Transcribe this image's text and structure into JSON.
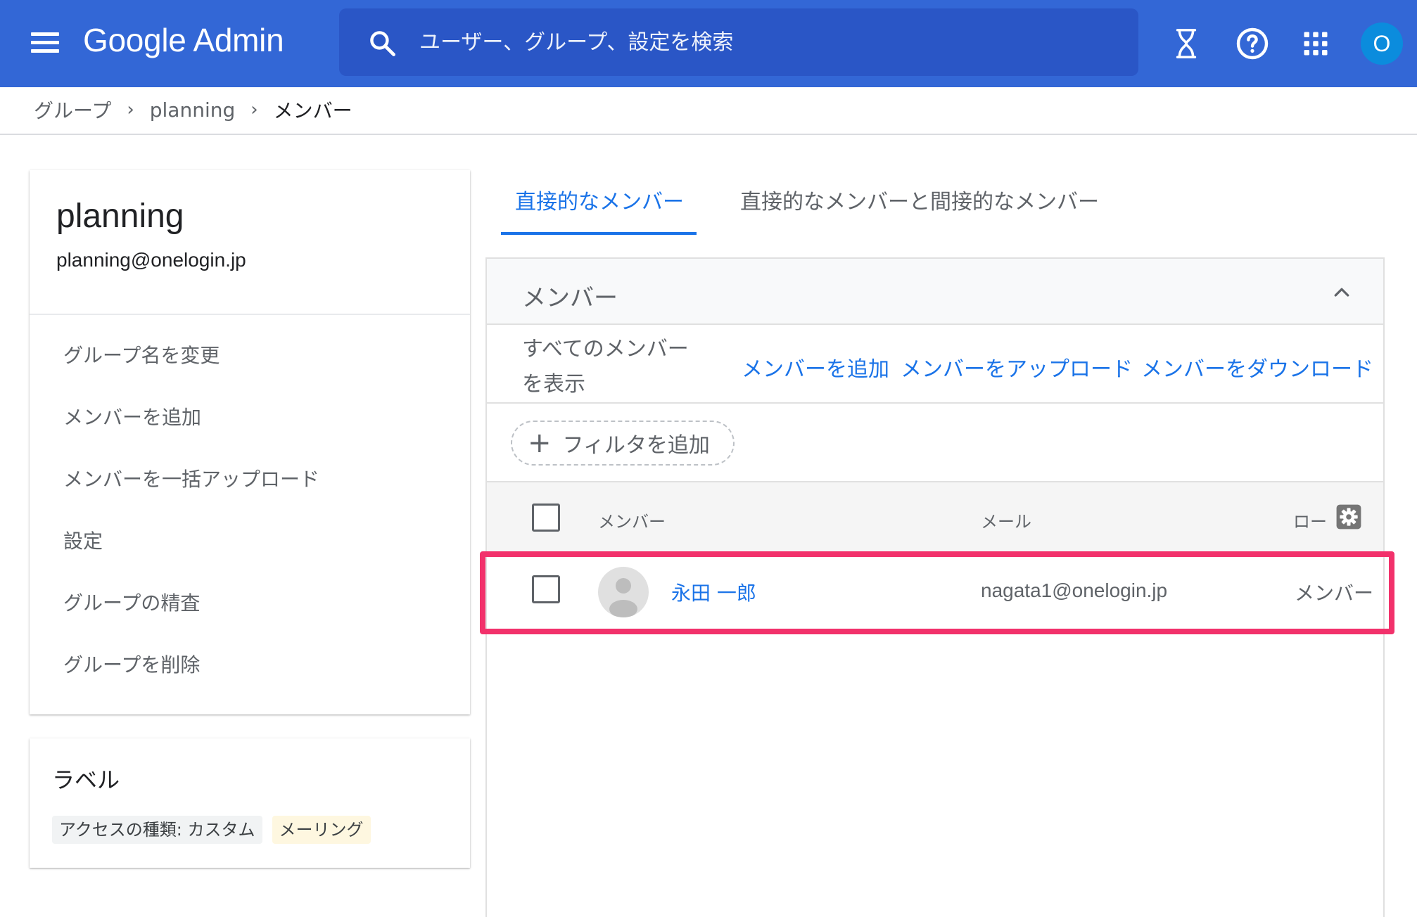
{
  "app": {
    "logo_text": "Google Admin"
  },
  "header": {
    "search_placeholder": "ユーザー、グループ、設定を検索",
    "account_initial": "O",
    "account_color": "#0b8cdd",
    "bar_color": "#3367d6",
    "icons": [
      "menu-icon",
      "search-icon",
      "hourglass-icon",
      "help-icon",
      "apps-grid-icon"
    ]
  },
  "breadcrumb": {
    "items": [
      "グループ",
      "planning"
    ],
    "current": "メンバー"
  },
  "group": {
    "name": "planning",
    "email": "planning@onelogin.jp",
    "actions": [
      "グループ名を変更",
      "メンバーを追加",
      "メンバーを一括アップロード",
      "設定",
      "グループの精査",
      "グループを削除"
    ]
  },
  "labels": {
    "title": "ラベル",
    "chips": [
      "アクセスの種類: カスタム",
      "メーリング"
    ]
  },
  "tabs": [
    {
      "label": "直接的なメンバー",
      "active": true
    },
    {
      "label": "直接的なメンバーと間接的なメンバー",
      "active": false
    }
  ],
  "members_panel": {
    "title": "メンバー",
    "show_all_line1": "すべてのメンバー",
    "show_all_line2": "を表示",
    "actions": [
      "メンバーを追加",
      "メンバーをアップロード",
      "メンバーをダウンロード"
    ],
    "filter_label": "フィルタを追加",
    "columns": {
      "member": "メンバー",
      "email": "メール",
      "role": "ロー"
    },
    "rows": [
      {
        "name": "永田 一郎",
        "email": "nagata1@onelogin.jp",
        "role": "メンバー",
        "checked": false
      }
    ]
  },
  "accent_color": "#1a73e8",
  "highlight_color": "#f2316b"
}
